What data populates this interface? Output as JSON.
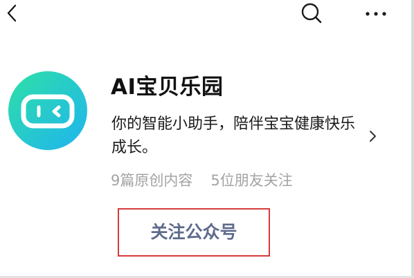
{
  "icons": {
    "back": "chevron-left-icon",
    "search": "search-icon",
    "more": "more-horizontal-icon",
    "avatar": "robot-face-icon",
    "chevron": "chevron-right-icon"
  },
  "account": {
    "name": "AI宝贝乐园",
    "description": "你的智能小助手，陪伴宝宝健康快乐成长。",
    "articles_count": "9篇原创内容",
    "friends_following": "5位朋友关注"
  },
  "actions": {
    "follow_label": "关注公众号"
  },
  "colors": {
    "avatar_gradient_start": "#2ee0a6",
    "avatar_gradient_end": "#1fb4f0",
    "follow_text": "#5e6b8d",
    "highlight_border": "#d63a3a",
    "stats_text": "#a3a3a3"
  }
}
